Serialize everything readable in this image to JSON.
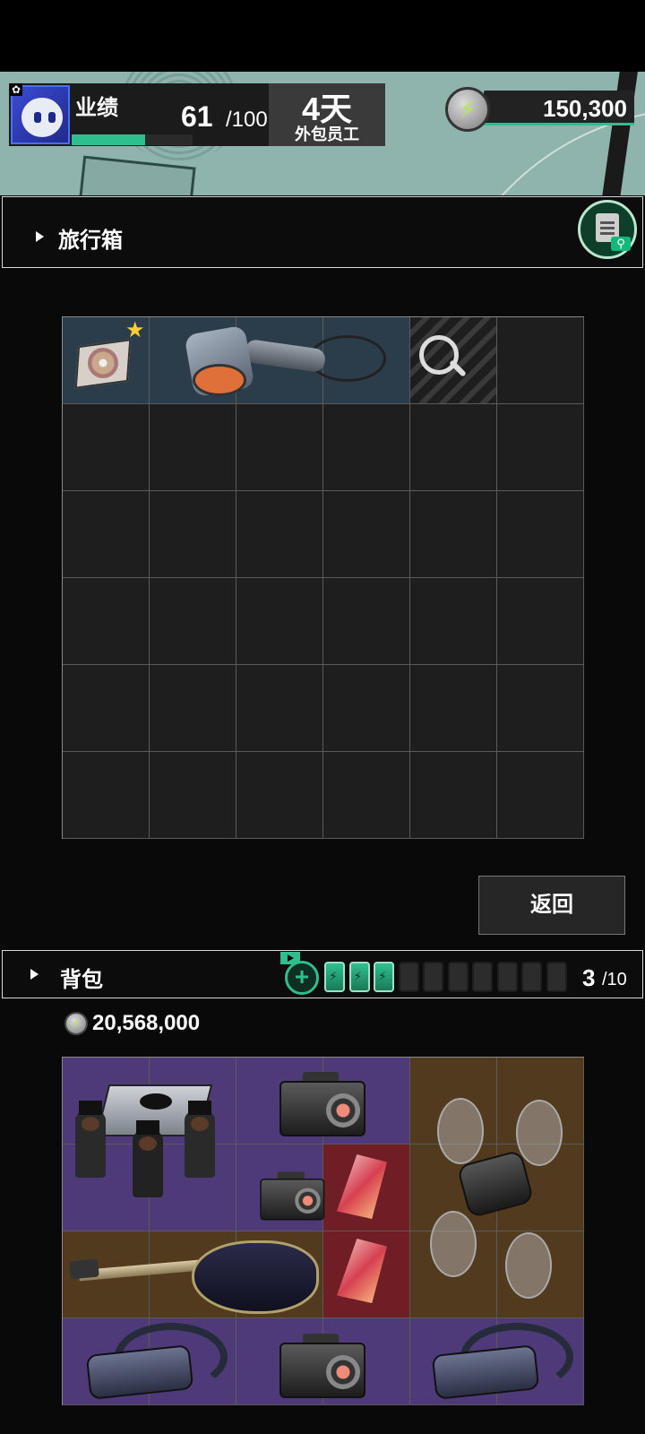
{
  "hud": {
    "performance_label": "业绩",
    "performance_current": "61",
    "performance_max": "/100",
    "performance_fraction": 0.61,
    "days_value": "4天",
    "days_subtitle": "外包员工",
    "energy_value": "150,300",
    "icons": [
      "gear-icon",
      "avatar",
      "energy-icon"
    ]
  },
  "suitcase": {
    "title": "旅行箱",
    "grid": {
      "columns": 6,
      "rows": 6
    },
    "items": [
      "disc-item",
      "hair-dryer-item"
    ],
    "search_slot_icon": "magnify-icon",
    "star_icon": "★"
  },
  "return_button": "返回",
  "backpack": {
    "title": "背包",
    "add_icon": "+",
    "batteries_full": 3,
    "batteries_total": 10,
    "slots_current": "3",
    "slots_max": "/10",
    "money": "20,568,000",
    "grid": {
      "columns": 6,
      "rows": 4
    },
    "items": [
      "coffin-dance-item",
      "camera-item",
      "camera-item",
      "video-camera-item",
      "crystal-item",
      "crystal-item",
      "guitar-item",
      "drone-item",
      "vr-goggles-item",
      "vr-goggles-item"
    ]
  },
  "colors": {
    "accent_green": "#2fbf8f",
    "purple_cell": "#4e3a78",
    "brown_cell": "#523a1f",
    "red_cell": "#6e1e24",
    "suitcase_highlight": "#2b3d4a"
  }
}
